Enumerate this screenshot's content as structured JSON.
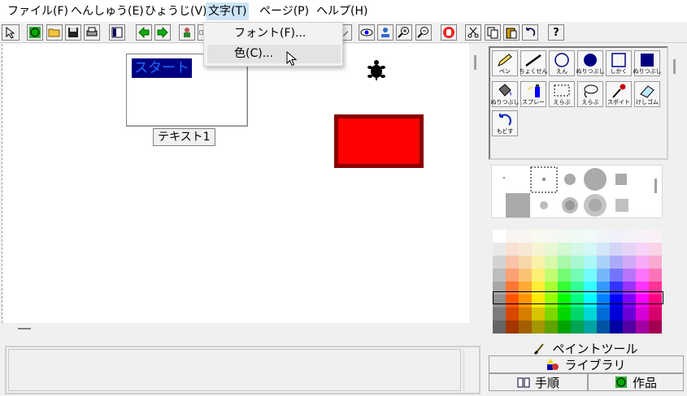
{
  "menubar": {
    "items": [
      {
        "label": "ファイル(F)"
      },
      {
        "label": "へんしゅう(E)"
      },
      {
        "label": "ひょうじ(V)"
      },
      {
        "label": "文字(T)"
      },
      {
        "label": "ページ(P)"
      },
      {
        "label": "ヘルプ(H)"
      }
    ]
  },
  "dropdown": {
    "items": [
      {
        "label": "フォント(F)..."
      },
      {
        "label": "色(C)..."
      }
    ]
  },
  "toolbar": {
    "help_glyph": "?"
  },
  "canvas": {
    "text_object_content": "スタート",
    "text_object_label": "テキスト1"
  },
  "tools": [
    {
      "label": "ペン",
      "icon": "pencil-icon"
    },
    {
      "label": "ちょくせん",
      "icon": "line-icon"
    },
    {
      "label": "えん",
      "icon": "circle-icon"
    },
    {
      "label": "ぬりつぶし",
      "icon": "filled-circle-icon"
    },
    {
      "label": "しかく",
      "icon": "square-icon"
    },
    {
      "label": "ぬりつぶし",
      "icon": "filled-square-icon"
    },
    {
      "label": "ぬりつぶし",
      "icon": "paint-bucket-icon"
    },
    {
      "label": "スプレー",
      "icon": "spray-icon"
    },
    {
      "label": "えらぶ",
      "icon": "rect-select-icon"
    },
    {
      "label": "えらぶ",
      "icon": "lasso-icon"
    },
    {
      "label": "スポイト",
      "icon": "eyedropper-icon"
    },
    {
      "label": "けしゴム",
      "icon": "eraser-icon"
    },
    {
      "label": "もどす",
      "icon": "undo-icon"
    }
  ],
  "bottom_tabs": {
    "paint_tool": "ペイントツール",
    "library": "ライブラリ",
    "steps": "手順",
    "works": "作品"
  },
  "colors": {
    "accent_menu": "#cce4f7",
    "text_highlight_bg": "#000080",
    "text_highlight_fg": "#1e6bff",
    "rect_fill": "#ff0000",
    "rect_border": "#8b0000"
  }
}
